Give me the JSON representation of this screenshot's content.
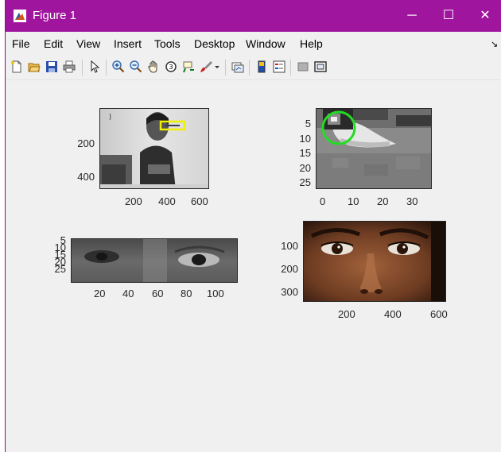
{
  "window": {
    "title": "Figure 1",
    "controls": {
      "minimize": "─",
      "maximize": "☐",
      "close": "✕"
    },
    "titlebar_color": "#a0159e"
  },
  "menu": {
    "items": [
      "File",
      "Edit",
      "View",
      "Insert",
      "Tools",
      "Desktop",
      "Window",
      "Help"
    ],
    "dock_arrow": "↘"
  },
  "toolbar": {
    "icons": [
      "new-figure-icon",
      "open-file-icon",
      "save-icon",
      "print-icon",
      "pointer-icon",
      "zoom-in-icon",
      "zoom-out-icon",
      "pan-hand-icon",
      "rotate-3d-icon",
      "data-cursor-icon",
      "brush-icon",
      "brush-dropdown-icon",
      "link-plot-icon",
      "colorbar-icon",
      "legend-icon",
      "hide-plot-tools-icon",
      "show-plot-tools-icon"
    ]
  },
  "axes": {
    "face": {
      "yticks": [
        "200",
        "400"
      ],
      "xticks": [
        "200",
        "400",
        "600"
      ],
      "annotation": {
        "shape": "rectangle",
        "color": "#f0f000"
      }
    },
    "eye_zoom": {
      "yticks": [
        "5",
        "10",
        "15",
        "20",
        "25"
      ],
      "xticks": [
        "0",
        "10",
        "20",
        "30"
      ],
      "annotation": {
        "shape": "circle",
        "color": "#22dd22"
      }
    },
    "eye_strip": {
      "yticks": [
        "5",
        "10",
        "15",
        "20",
        "25"
      ],
      "xticks": [
        "20",
        "40",
        "60",
        "80",
        "100"
      ]
    },
    "woman_eyes": {
      "yticks": [
        "100",
        "200",
        "300"
      ],
      "xticks": [
        "200",
        "400",
        "600"
      ]
    }
  }
}
